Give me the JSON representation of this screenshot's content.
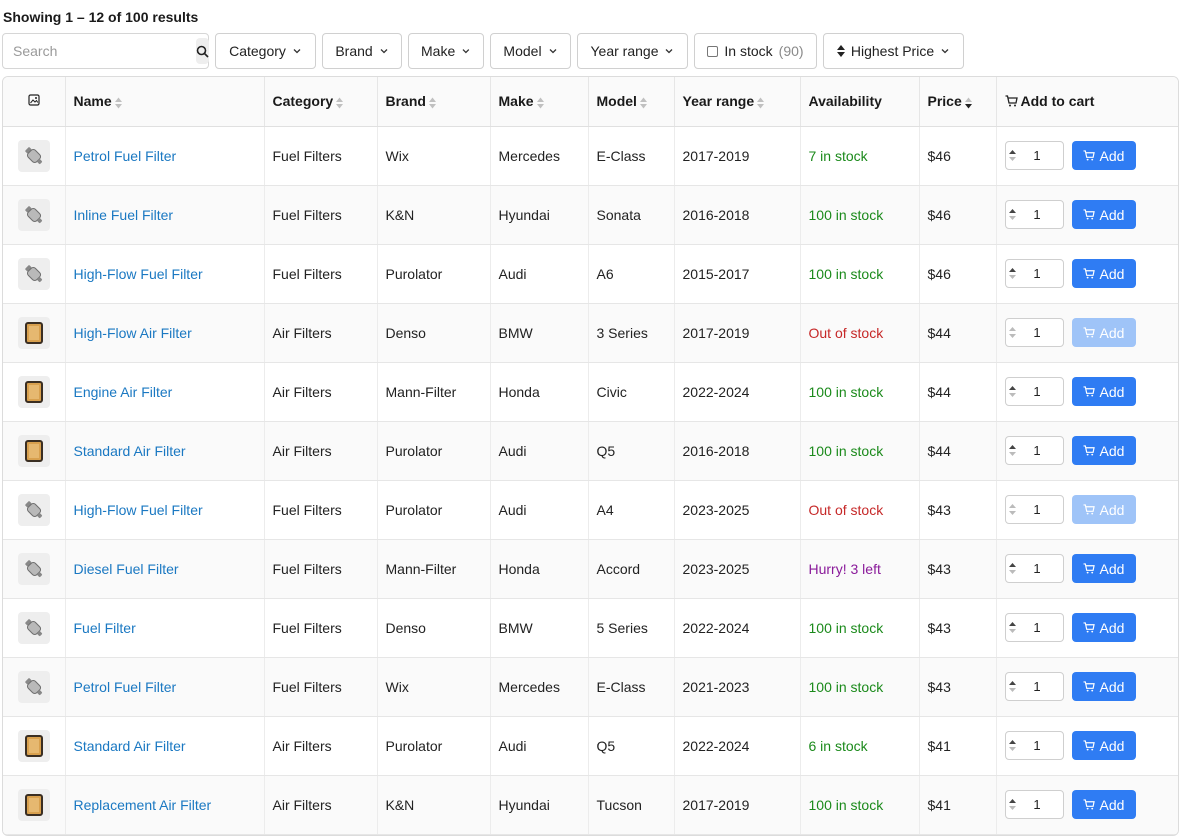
{
  "results_text": "Showing 1 – 12 of 100 results",
  "search": {
    "placeholder": "Search",
    "value": ""
  },
  "filters": {
    "category": "Category",
    "brand": "Brand",
    "make": "Make",
    "model": "Model",
    "year_range": "Year range",
    "in_stock": "In stock",
    "in_stock_count": "(90)",
    "sort": "Highest Price"
  },
  "columns": {
    "name": "Name",
    "category": "Category",
    "brand": "Brand",
    "make": "Make",
    "model": "Model",
    "year_range": "Year range",
    "availability": "Availability",
    "price": "Price",
    "cart": "Add to cart"
  },
  "add_label": "Add",
  "colors": {
    "link": "#1a78c2",
    "in_stock": "#1b8a1b",
    "out_of_stock": "#c62828",
    "hurry": "#8a1a9a",
    "add_button": "#2f7cf3",
    "add_button_disabled": "#9fc4f8"
  },
  "rows": [
    {
      "thumb": "fuel-filter-icon",
      "name": "Petrol Fuel Filter",
      "category": "Fuel Filters",
      "brand": "Wix",
      "make": "Mercedes",
      "model": "E-Class",
      "years": "2017-2019",
      "availability": "7 in stock",
      "status": "in",
      "price": "$46",
      "qty": "1"
    },
    {
      "thumb": "fuel-filter-icon",
      "name": "Inline Fuel Filter",
      "category": "Fuel Filters",
      "brand": "K&N",
      "make": "Hyundai",
      "model": "Sonata",
      "years": "2016-2018",
      "availability": "100 in stock",
      "status": "in",
      "price": "$46",
      "qty": "1"
    },
    {
      "thumb": "fuel-filter-icon",
      "name": "High-Flow Fuel Filter",
      "category": "Fuel Filters",
      "brand": "Purolator",
      "make": "Audi",
      "model": "A6",
      "years": "2015-2017",
      "availability": "100 in stock",
      "status": "in",
      "price": "$46",
      "qty": "1"
    },
    {
      "thumb": "air-filter-icon",
      "name": "High-Flow Air Filter",
      "category": "Air Filters",
      "brand": "Denso",
      "make": "BMW",
      "model": "3 Series",
      "years": "2017-2019",
      "availability": "Out of stock",
      "status": "out",
      "price": "$44",
      "qty": "1"
    },
    {
      "thumb": "air-filter-icon",
      "name": "Engine Air Filter",
      "category": "Air Filters",
      "brand": "Mann-Filter",
      "make": "Honda",
      "model": "Civic",
      "years": "2022-2024",
      "availability": "100 in stock",
      "status": "in",
      "price": "$44",
      "qty": "1"
    },
    {
      "thumb": "air-filter-icon",
      "name": "Standard Air Filter",
      "category": "Air Filters",
      "brand": "Purolator",
      "make": "Audi",
      "model": "Q5",
      "years": "2016-2018",
      "availability": "100 in stock",
      "status": "in",
      "price": "$44",
      "qty": "1"
    },
    {
      "thumb": "fuel-filter-icon",
      "name": "High-Flow Fuel Filter",
      "category": "Fuel Filters",
      "brand": "Purolator",
      "make": "Audi",
      "model": "A4",
      "years": "2023-2025",
      "availability": "Out of stock",
      "status": "out",
      "price": "$43",
      "qty": "1"
    },
    {
      "thumb": "fuel-filter-icon",
      "name": "Diesel Fuel Filter",
      "category": "Fuel Filters",
      "brand": "Mann-Filter",
      "make": "Honda",
      "model": "Accord",
      "years": "2023-2025",
      "availability": "Hurry! 3 left",
      "status": "hurry",
      "price": "$43",
      "qty": "1"
    },
    {
      "thumb": "fuel-filter-icon",
      "name": "Fuel Filter",
      "category": "Fuel Filters",
      "brand": "Denso",
      "make": "BMW",
      "model": "5 Series",
      "years": "2022-2024",
      "availability": "100 in stock",
      "status": "in",
      "price": "$43",
      "qty": "1"
    },
    {
      "thumb": "fuel-filter-icon",
      "name": "Petrol Fuel Filter",
      "category": "Fuel Filters",
      "brand": "Wix",
      "make": "Mercedes",
      "model": "E-Class",
      "years": "2021-2023",
      "availability": "100 in stock",
      "status": "in",
      "price": "$43",
      "qty": "1"
    },
    {
      "thumb": "air-filter-icon",
      "name": "Standard Air Filter",
      "category": "Air Filters",
      "brand": "Purolator",
      "make": "Audi",
      "model": "Q5",
      "years": "2022-2024",
      "availability": "6 in stock",
      "status": "in",
      "price": "$41",
      "qty": "1"
    },
    {
      "thumb": "air-filter-icon",
      "name": "Replacement Air Filter",
      "category": "Air Filters",
      "brand": "K&N",
      "make": "Hyundai",
      "model": "Tucson",
      "years": "2017-2019",
      "availability": "100 in stock",
      "status": "in",
      "price": "$41",
      "qty": "1"
    }
  ]
}
